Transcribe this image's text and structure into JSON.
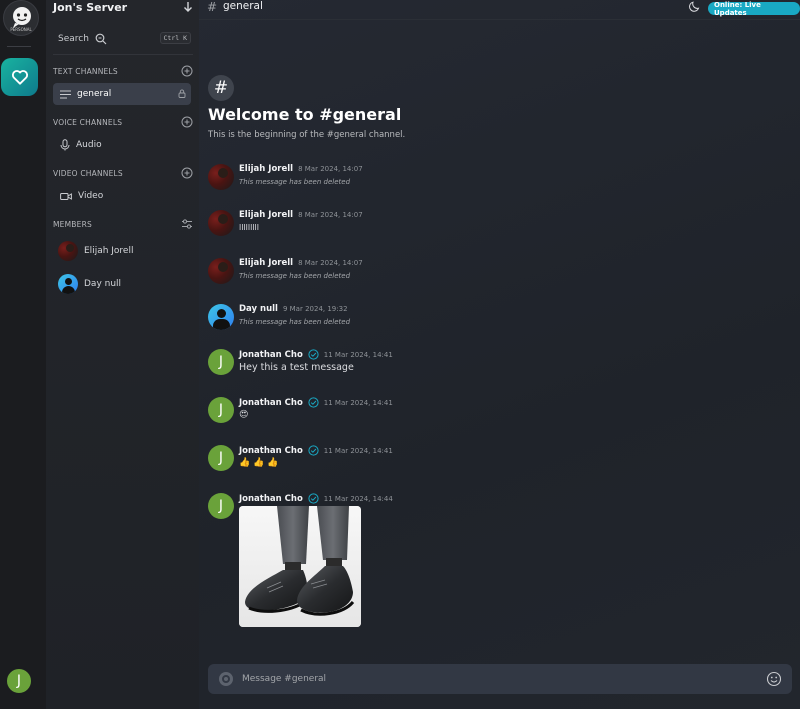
{
  "rail": {
    "logo_text": "PERSONAL",
    "user_initial": "J"
  },
  "server": {
    "name": "Jon's Server",
    "search_label": "Search",
    "search_shortcut": "Ctrl K"
  },
  "sections": {
    "text": "Text channels",
    "voice": "Voice channels",
    "video": "Video channels",
    "members": "Members"
  },
  "channels": {
    "text": [
      {
        "label": "general",
        "active": true
      }
    ],
    "voice": [
      {
        "label": "Audio"
      }
    ],
    "video": [
      {
        "label": "Video"
      }
    ]
  },
  "members": [
    {
      "name": "Elijah Jorell",
      "avatar": "photo"
    },
    {
      "name": "Day null",
      "avatar": "default-blue"
    }
  ],
  "header": {
    "channel_name": "general",
    "status_badge": "Online: Live Updates",
    "theme_icon": "moon-icon"
  },
  "welcome": {
    "icon": "#",
    "title": "Welcome to #general",
    "subtitle": "This is the beginning of the #general channel."
  },
  "messages": [
    {
      "author": "Elijah Jorell",
      "timestamp": "8 Mar 2024, 14:07",
      "content": "This message has been deleted",
      "deleted": true,
      "verified": false
    },
    {
      "author": "Elijah Jorell",
      "timestamp": "8 Mar 2024, 14:07",
      "content": "lllllllll",
      "deleted": false,
      "verified": false
    },
    {
      "author": "Elijah Jorell",
      "timestamp": "8 Mar 2024, 14:07",
      "content": "This message has been deleted",
      "deleted": true,
      "verified": false
    },
    {
      "author": "Day null",
      "timestamp": "9 Mar 2024, 19:32",
      "content": "This message has been deleted",
      "deleted": true,
      "verified": false
    },
    {
      "author": "Jonathan Cho",
      "timestamp": "11 Mar 2024, 14:41",
      "content": "Hey this a test message",
      "deleted": false,
      "verified": true
    },
    {
      "author": "Jonathan Cho",
      "timestamp": "11 Mar 2024, 14:41",
      "content": "😍",
      "deleted": false,
      "verified": true
    },
    {
      "author": "Jonathan Cho",
      "timestamp": "11 Mar 2024, 14:41",
      "content": "👍 👍 👍",
      "deleted": false,
      "verified": true
    },
    {
      "author": "Jonathan Cho",
      "timestamp": "11 Mar 2024, 14:44",
      "content": "",
      "attachment": "image of black leather dress shoes",
      "deleted": false,
      "verified": true
    }
  ],
  "composer": {
    "placeholder": "Message #general"
  },
  "colors": {
    "accent": "#19a9c4",
    "avatar_green": "#6aa23a",
    "active_channel": "#3a3f4a"
  }
}
